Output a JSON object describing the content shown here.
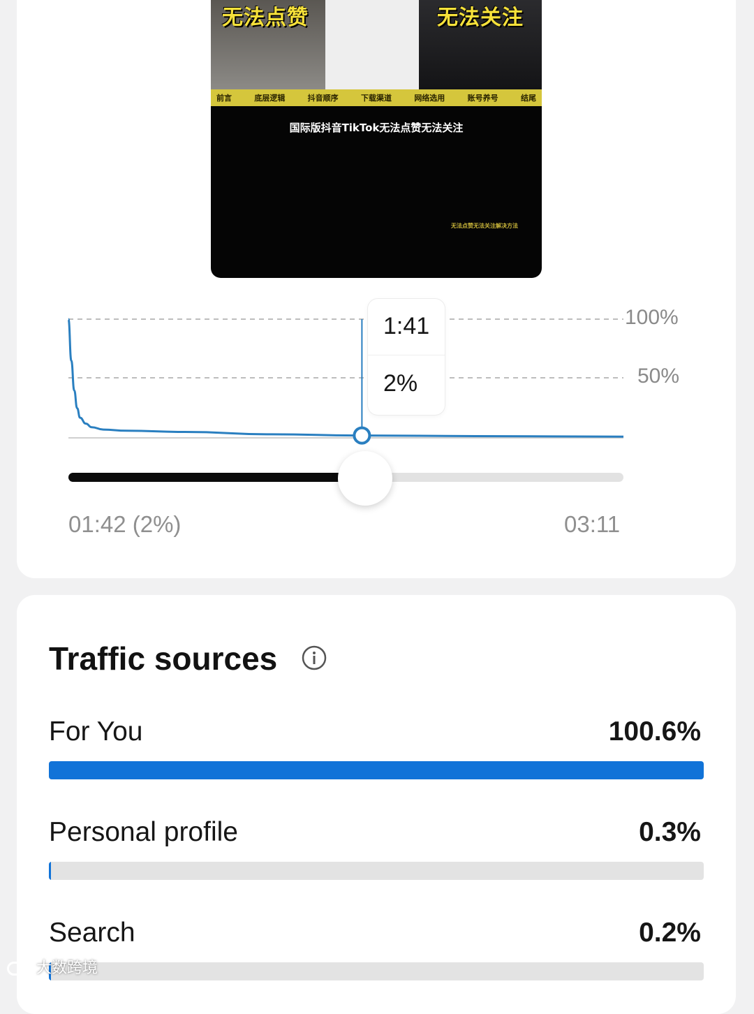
{
  "video": {
    "caption_left": "无法点赞",
    "caption_right": "无法关注",
    "nav_items": [
      "前言",
      "底层逻辑",
      "抖音顺序",
      "下载渠道",
      "网络选用",
      "账号养号",
      "结尾"
    ],
    "title": "国际版抖音TikTok无法点赞无法关注",
    "footer": "无法点赞无法关注解决方法"
  },
  "retention": {
    "tooltip_time": "1:41",
    "tooltip_percent": "2%",
    "y_label_100": "100%",
    "y_label_50": "50%",
    "current_position": "01:42 (2%)",
    "duration": "03:11",
    "playhead_fraction": 0.534,
    "line_color": "#2a7fc0"
  },
  "chart_data": {
    "type": "line",
    "title": "",
    "xlabel": "",
    "ylabel": "",
    "x_unit": "seconds",
    "xlim": [
      0,
      191
    ],
    "ylim": [
      0,
      100
    ],
    "y_ticks": [
      "100%",
      "50%"
    ],
    "series": [
      {
        "x": [
          0,
          1,
          2,
          3,
          4,
          6,
          8,
          12,
          20,
          40,
          70,
          101,
          140,
          191
        ],
        "y": [
          100,
          65,
          40,
          25,
          17,
          12,
          9,
          7,
          6,
          5,
          3,
          2,
          1.5,
          1
        ]
      }
    ],
    "highlight": {
      "x": 101,
      "y": 2
    }
  },
  "traffic": {
    "title": "Traffic sources",
    "sources": [
      {
        "label": "For You",
        "value": "100.6%",
        "fraction": 1.0
      },
      {
        "label": "Personal profile",
        "value": "0.3%",
        "fraction": 0.003
      },
      {
        "label": "Search",
        "value": "0.2%",
        "fraction": 0.002
      }
    ],
    "bar_color": "#1173d8"
  },
  "watermark": {
    "text": "大数跨境"
  }
}
